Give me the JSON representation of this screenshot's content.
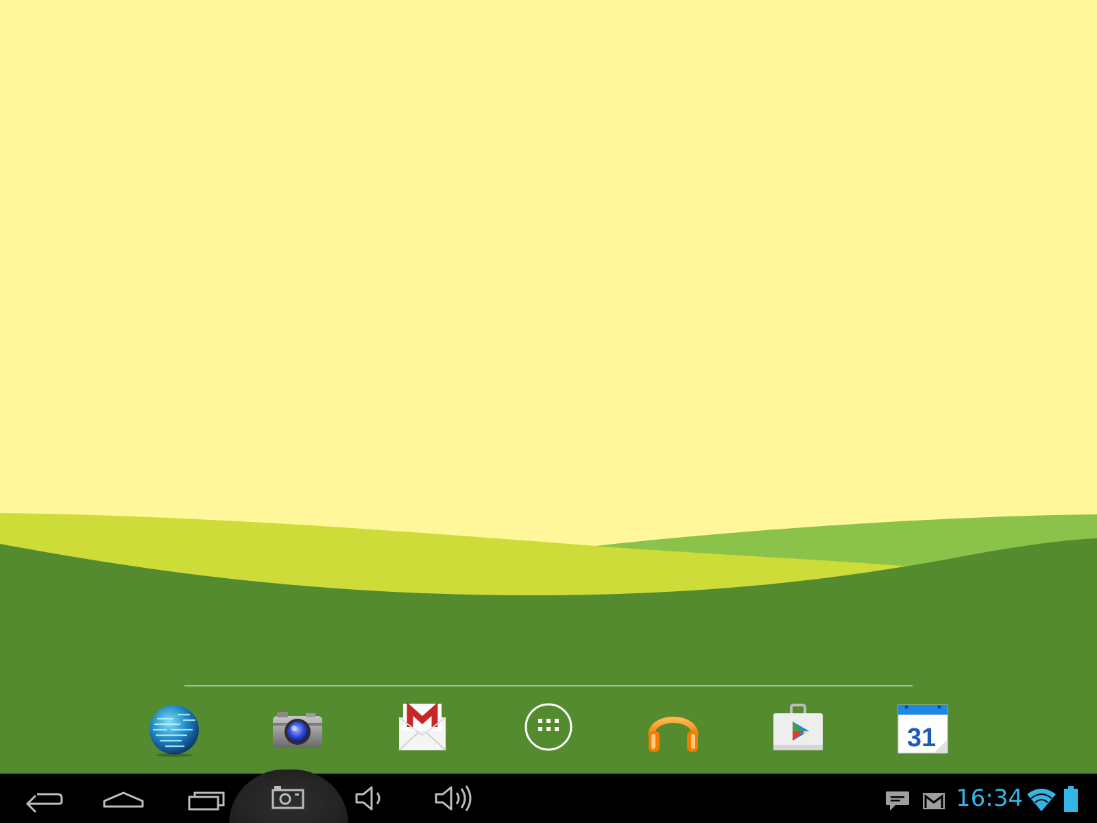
{
  "colors": {
    "sky": "#FFF799",
    "hill_light_green": "#8BC34A",
    "hill_lime": "#CDDC39",
    "hill_dark_green": "#558B2F",
    "navbar": "#000000",
    "clock": "#33B5E5",
    "nav_icon": "#BDBDBD"
  },
  "dock": {
    "apps": [
      {
        "name": "browser",
        "icon": "globe-icon"
      },
      {
        "name": "camera",
        "icon": "camera-icon"
      },
      {
        "name": "gmail",
        "icon": "gmail-icon"
      },
      {
        "name": "all-apps",
        "icon": "app-drawer-icon"
      },
      {
        "name": "play-music",
        "icon": "headphones-icon"
      },
      {
        "name": "play-store",
        "icon": "play-store-icon"
      },
      {
        "name": "calendar",
        "icon": "calendar-icon",
        "label": "31"
      }
    ]
  },
  "navbar": {
    "buttons": [
      "back-icon",
      "home-icon",
      "recent-apps-icon",
      "screenshot-icon",
      "volume-down-icon",
      "volume-up-icon"
    ]
  },
  "status_bar": {
    "time": "16:34",
    "icons": [
      "chat-notification-icon",
      "gmail-notification-icon",
      "wifi-icon",
      "battery-icon"
    ]
  }
}
